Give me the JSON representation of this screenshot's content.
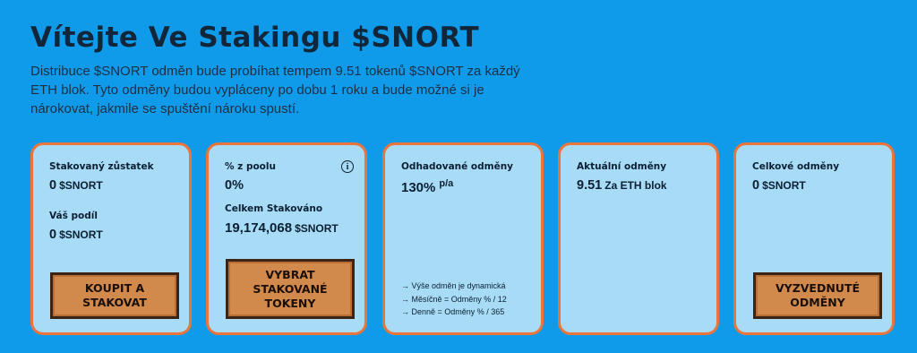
{
  "header": {
    "title": "Vítejte Ve Stakingu $SNORT",
    "description": "Distribuce $SNORT odměn bude probíhat tempem 9.51 tokenů $SNORT za každý ETH blok. Tyto odměny budou vypláceny po dobu 1 roku a bude možné si je nárokovat, jakmile se spuštění nároku spustí."
  },
  "cards": {
    "balance": {
      "staked_label": "Stakovaný zůstatek",
      "staked_value": "0",
      "staked_unit": "$SNORT",
      "share_label": "Váš podíl",
      "share_value": "0",
      "share_unit": "$SNORT",
      "button": "KOUPIT A STAKOVAT"
    },
    "pool": {
      "percent_label": "% z poolu",
      "percent_value": "0%",
      "total_label": "Celkem Stakováno",
      "total_value": "19,174,068",
      "total_unit": "$SNORT",
      "button": "VYBRAT STAKOVANÉ TOKENY",
      "info_icon": "i"
    },
    "estimated": {
      "label": "Odhadované odměny",
      "value": "130%",
      "suffix": "p/a",
      "notes": [
        "→ Výše odměn je dynamická",
        "→ Měsíčně = Odměny % / 12",
        "→ Denně = Odměny % / 365"
      ]
    },
    "current": {
      "label": "Aktuální odměny",
      "value": "9.51",
      "unit": "Za ETH blok"
    },
    "total": {
      "label": "Celkové odměny",
      "value": "0",
      "unit": "$SNORT",
      "button": "VYZVEDNUTÉ ODMĚNY"
    }
  },
  "colors": {
    "background": "#0f9bea",
    "card": "#a8dcf6",
    "card_border": "#e9753d",
    "button": "#d28a4c"
  }
}
